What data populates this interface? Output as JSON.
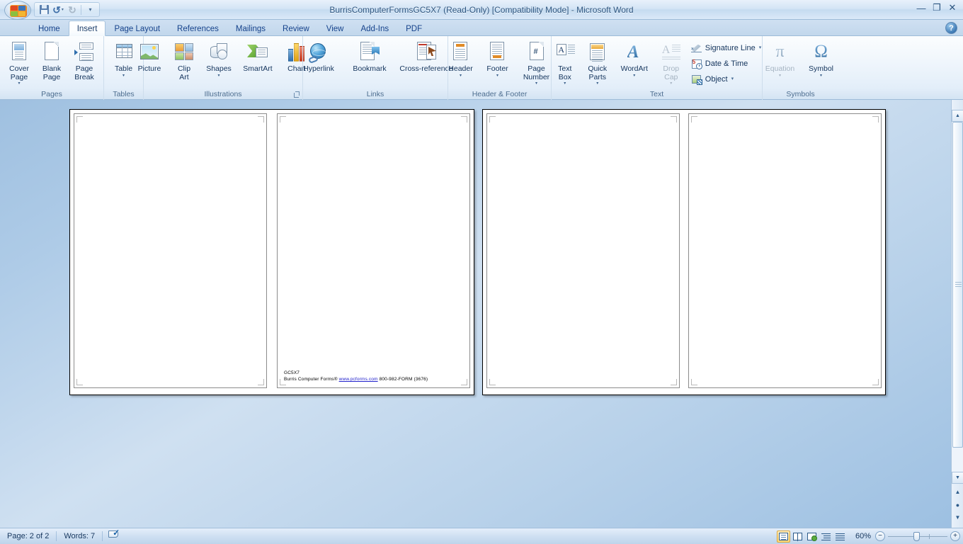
{
  "window": {
    "title": "BurrisComputerFormsGC5X7 (Read-Only) [Compatibility Mode] - Microsoft Word",
    "minimize": "—",
    "restore": "❐",
    "close": "✕",
    "help": "?"
  },
  "quick_access": {
    "office_button": "Office Button",
    "save": "Save",
    "undo": "↺",
    "undo_arrow": "▾",
    "redo": "↻",
    "customize_arrow": "▾"
  },
  "tabs": [
    {
      "label": "Home",
      "active": false
    },
    {
      "label": "Insert",
      "active": true
    },
    {
      "label": "Page Layout",
      "active": false
    },
    {
      "label": "References",
      "active": false
    },
    {
      "label": "Mailings",
      "active": false
    },
    {
      "label": "Review",
      "active": false
    },
    {
      "label": "View",
      "active": false
    },
    {
      "label": "Add-Ins",
      "active": false
    },
    {
      "label": "PDF",
      "active": false
    }
  ],
  "ribbon": {
    "groups": [
      {
        "name": "Pages",
        "title": "Pages",
        "buttons": [
          {
            "label": "Cover\nPage",
            "arrow": "▾",
            "icon": "cover-page-icon"
          },
          {
            "label": "Blank\nPage",
            "arrow": "",
            "icon": "blank-page-icon"
          },
          {
            "label": "Page\nBreak",
            "arrow": "",
            "icon": "page-break-icon"
          }
        ]
      },
      {
        "name": "Tables",
        "title": "Tables",
        "buttons": [
          {
            "label": "Table",
            "arrow": "▾",
            "icon": "table-icon"
          }
        ]
      },
      {
        "name": "Illustrations",
        "title": "Illustrations",
        "buttons": [
          {
            "label": "Picture",
            "arrow": "",
            "icon": "picture-icon"
          },
          {
            "label": "Clip\nArt",
            "arrow": "",
            "icon": "clip-art-icon"
          },
          {
            "label": "Shapes",
            "arrow": "▾",
            "icon": "shapes-icon"
          },
          {
            "label": "SmartArt",
            "arrow": "",
            "icon": "smartart-icon"
          },
          {
            "label": "Chart",
            "arrow": "",
            "icon": "chart-icon"
          }
        ]
      },
      {
        "name": "Links",
        "title": "Links",
        "buttons": [
          {
            "label": "Hyperlink",
            "arrow": "",
            "icon": "hyperlink-icon"
          },
          {
            "label": "Bookmark",
            "arrow": "",
            "icon": "bookmark-icon"
          },
          {
            "label": "Cross-reference",
            "arrow": "",
            "icon": "cross-reference-icon"
          }
        ]
      },
      {
        "name": "Header & Footer",
        "title": "Header & Footer",
        "buttons": [
          {
            "label": "Header",
            "arrow": "▾",
            "icon": "header-icon"
          },
          {
            "label": "Footer",
            "arrow": "▾",
            "icon": "footer-icon"
          },
          {
            "label": "Page\nNumber",
            "arrow": "▾",
            "icon": "page-number-icon"
          }
        ]
      },
      {
        "name": "Text",
        "title": "Text",
        "buttons": [
          {
            "label": "Text\nBox",
            "arrow": "▾",
            "icon": "text-box-icon"
          },
          {
            "label": "Quick\nParts",
            "arrow": "▾",
            "icon": "quick-parts-icon"
          },
          {
            "label": "WordArt",
            "arrow": "▾",
            "icon": "wordart-icon"
          },
          {
            "label": "Drop\nCap",
            "arrow": "▾",
            "icon": "drop-cap-icon",
            "disabled": true
          }
        ],
        "small_buttons": [
          {
            "label": "Signature Line",
            "arrow": "▾",
            "icon": "signature-line-icon"
          },
          {
            "label": "Date & Time",
            "arrow": "",
            "icon": "date-time-icon"
          },
          {
            "label": "Object",
            "arrow": "▾",
            "icon": "object-icon"
          }
        ]
      },
      {
        "name": "Symbols",
        "title": "Symbols",
        "buttons": [
          {
            "label": "Equation",
            "arrow": "▾",
            "icon": "equation-icon",
            "glyph": "π",
            "disabled": true
          },
          {
            "label": "Symbol",
            "arrow": "▾",
            "icon": "symbol-icon",
            "glyph": "Ω"
          }
        ]
      }
    ]
  },
  "document": {
    "pages": [
      {
        "index": 1,
        "content": ""
      },
      {
        "index": 2,
        "content": ""
      },
      {
        "index": 3,
        "content": ""
      },
      {
        "index": 4,
        "content": ""
      }
    ],
    "footer_line1": "GC5X7",
    "footer_line2_pre": "Burris Computer Forms",
    "footer_reg_mark": "®",
    "footer_link": "www.pcforms.com",
    "footer_line2_post": " 800-982-FORM (3676)"
  },
  "status_bar": {
    "page": "Page: 2 of 2",
    "words": "Words: 7",
    "proofing": "proofing-errors-icon",
    "views": [
      {
        "name": "print-layout",
        "label": "Print Layout",
        "active": true
      },
      {
        "name": "full-screen-reading",
        "label": "Full Screen Reading",
        "active": false
      },
      {
        "name": "web-layout",
        "label": "Web Layout",
        "active": false
      },
      {
        "name": "outline",
        "label": "Outline",
        "active": false
      },
      {
        "name": "draft",
        "label": "Draft",
        "active": false
      }
    ],
    "zoom_value": "60%",
    "zoom_out": "−",
    "zoom_in": "+"
  },
  "scrollbar": {
    "up_arrow": "▲",
    "down_arrow": "▼",
    "prev_page": "▲",
    "select_browse_object": "●",
    "next_page": "▼"
  },
  "colors": {
    "ribbon_bg": "#eef5fc",
    "title_text": "#2c5580",
    "accent": "#15428b",
    "doc_bg": "#aecbe7",
    "page_white": "#ffffff",
    "link_blue": "#2222cc"
  }
}
